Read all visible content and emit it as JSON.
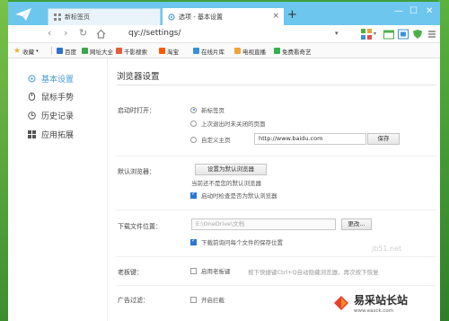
{
  "tabs": [
    {
      "title": "新标签页",
      "active": false
    },
    {
      "title": "选项 - 基本设置",
      "active": true
    }
  ],
  "toolbar": {
    "url": "qy://settings/"
  },
  "bookmarks": [
    {
      "label": "收藏",
      "icon": "star-icon"
    },
    {
      "label": "百度",
      "icon": "baidu-icon"
    },
    {
      "label": "网址大全",
      "icon": "sites-icon"
    },
    {
      "label": "千影搜索",
      "icon": "search-icon"
    },
    {
      "label": "淘宝",
      "icon": "taobao-icon"
    },
    {
      "label": "在线片库",
      "icon": "video-icon"
    },
    {
      "label": "电视直播",
      "icon": "tv-icon"
    },
    {
      "label": "免费看奇艺",
      "icon": "iqiyi-icon"
    }
  ],
  "sidebar": {
    "items": [
      {
        "label": "基本设置",
        "icon": "gear-icon",
        "active": true
      },
      {
        "label": "鼠标手势",
        "icon": "mouse-icon",
        "active": false
      },
      {
        "label": "历史记录",
        "icon": "clock-icon",
        "active": false
      },
      {
        "label": "应用拓展",
        "icon": "apps-icon",
        "active": false
      }
    ]
  },
  "settings": {
    "title": "浏览器设置",
    "startup": {
      "label": "启动时打开：",
      "options": [
        {
          "label": "新标签页",
          "selected": true
        },
        {
          "label": "上次退出时未关闭的页面",
          "selected": false
        },
        {
          "label": "自定义主页",
          "selected": false
        }
      ],
      "homepage_value": "http://www.baidu.com",
      "save_label": "保存"
    },
    "default_browser": {
      "label": "默认浏览器：",
      "button": "设置为默认浏览器",
      "status": "当前还不是您的默认浏览器",
      "check_label": "启动时检查是否为默认浏览器",
      "checked": true
    },
    "download": {
      "label": "下载文件位置：",
      "path_placeholder": "E:\\OneDrive\\文档",
      "change_label": "更改...",
      "ask_label": "下载前询问每个文件的保存位置",
      "ask_checked": true
    },
    "boss_key": {
      "label": "老板键：",
      "check_label": "启用老板键",
      "checked": false,
      "hint": "按下快捷键Ctrl+Q自动隐藏浏览器，再次按下恢复"
    },
    "ad_filter": {
      "label": "广告过滤：",
      "check_label": "开启拦截",
      "checked": false
    }
  },
  "watermark": {
    "small": "jb51.net",
    "main": "易采站长站",
    "sub": "www.easck.com"
  },
  "colors": {
    "tabbar": "#6cc6ee",
    "accent": "#4a9bd6",
    "desktop": "#3f9e3a"
  }
}
